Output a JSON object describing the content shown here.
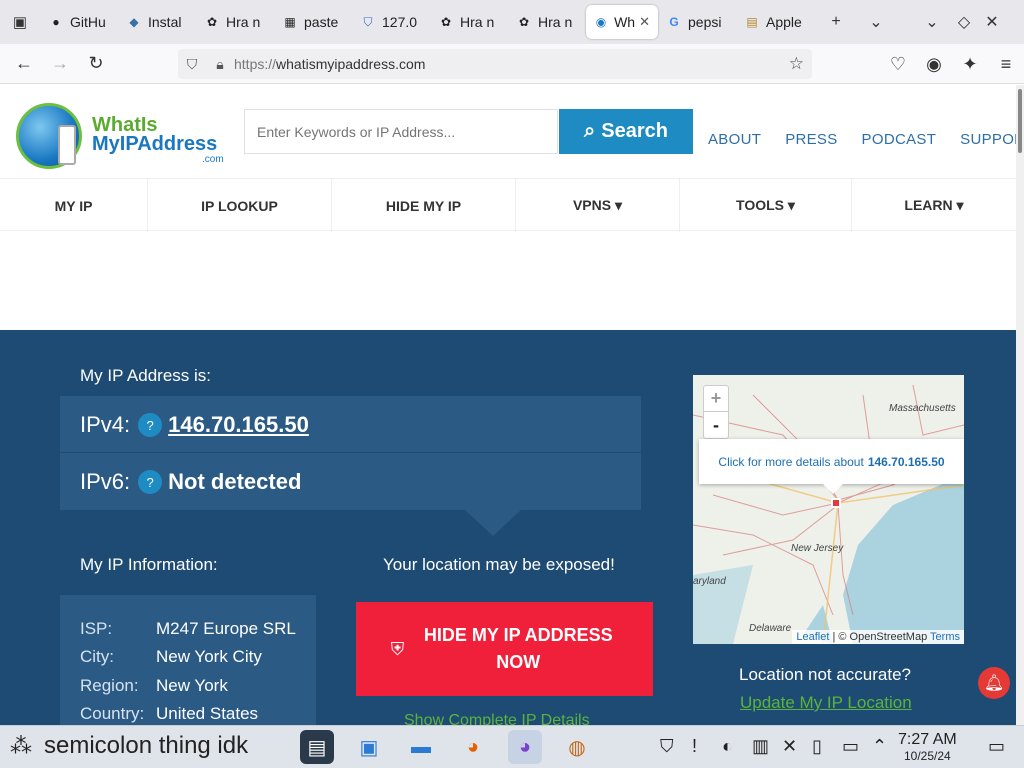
{
  "browser": {
    "tabs": [
      {
        "label": "GitHu",
        "icon": "github-icon"
      },
      {
        "label": "Instal",
        "icon": "python-icon"
      },
      {
        "label": "Hra n",
        "icon": "chatgpt-icon"
      },
      {
        "label": "paste",
        "icon": "pastebin-icon"
      },
      {
        "label": "127.0",
        "icon": "shield-icon"
      },
      {
        "label": "Hra n",
        "icon": "chatgpt-icon"
      },
      {
        "label": "Hra n",
        "icon": "chatgpt-icon"
      },
      {
        "label": "Wh",
        "icon": "globe-icon",
        "active": true
      },
      {
        "label": "pepsi",
        "icon": "google-icon"
      },
      {
        "label": "Apple",
        "icon": "store-icon"
      }
    ],
    "url_protocol": "https://",
    "url_host": "whatismyipaddress.com"
  },
  "site": {
    "logo_line1": "WhatIs",
    "logo_line2": "MyIPAddress",
    "logo_line3": ".com",
    "search_placeholder": "Enter Keywords or IP Address...",
    "search_button": "Search",
    "top_links": [
      "ABOUT",
      "PRESS",
      "PODCAST",
      "SUPPORT"
    ],
    "menu": [
      "MY IP",
      "IP LOOKUP",
      "HIDE MY IP",
      "VPNS ▾",
      "TOOLS ▾",
      "LEARN ▾"
    ]
  },
  "hero": {
    "my_ip_label": "My IP Address is:",
    "ipv4_label": "IPv4:",
    "ipv4_value": "146.70.165.50",
    "ipv6_label": "IPv6:",
    "ipv6_value": "Not detected",
    "help_mark": "?",
    "info_label": "My IP Information:",
    "exposed_label": "Your location may be exposed!",
    "info": [
      {
        "k": "ISP:",
        "v": "M247 Europe SRL"
      },
      {
        "k": "City:",
        "v": "New York City"
      },
      {
        "k": "Region:",
        "v": "New York"
      },
      {
        "k": "Country:",
        "v": "United States"
      }
    ],
    "hide_button": "HIDE MY IP ADDRESS NOW",
    "show_details": "Show Complete IP Details",
    "map": {
      "popup_text": "Click for more details about",
      "popup_ip": "146.70.165.50",
      "labels": [
        "Massachusetts",
        "New Jersey",
        "aryland",
        "Delaware"
      ],
      "attribution_leaflet": "Leaflet",
      "attribution_osm": "| © OpenStreetMap",
      "attribution_terms": "Terms",
      "zoom_in": "+",
      "zoom_out": "-"
    },
    "location_question": "Location not accurate?",
    "update_link": "Update My IP Location"
  },
  "taskbar": {
    "title": "semicolon thing idk",
    "time": "7:27 AM",
    "date": "10/25/24"
  }
}
